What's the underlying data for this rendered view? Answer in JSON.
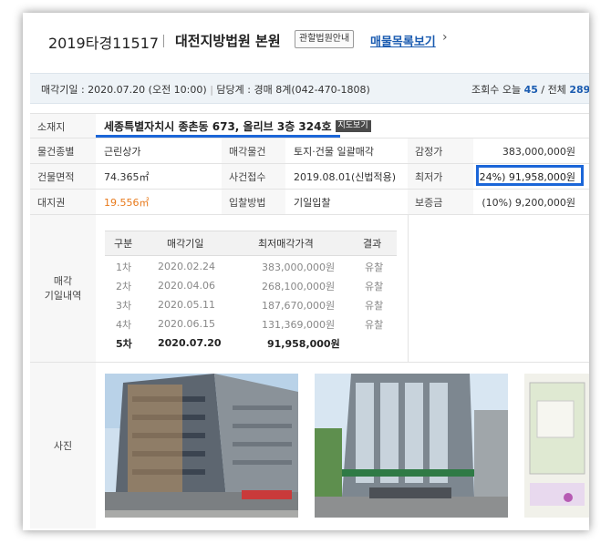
{
  "header": {
    "case_no": "2019타경11517",
    "court": "대전지방법원 본원",
    "court_info_button": "관할법원안내",
    "list_link": "매물목록보기",
    "list_chevron": "›"
  },
  "infobar": {
    "sale_date_text": "매각기일 : 2020.07.20 (오전 10:00)",
    "divider": "|",
    "department_text": "담당계 : 경매 8계(042-470-1808)",
    "views_label": "조회수 오늘",
    "views_today": "45",
    "views_sep": "/ 전체",
    "views_total": "289"
  },
  "property": {
    "location_label": "소재지",
    "address": "세종특별자치시 종촌동 673, 올리브 3층 324호",
    "map_button": "지도보기",
    "rows": [
      {
        "l1": "물건종별",
        "v1": "근린상가",
        "l2": "매각물건",
        "v2": "토지·건물 일괄매각",
        "l3": "감정가",
        "v3": "383,000,000원"
      },
      {
        "l1": "건물면적",
        "v1": "74.365㎡",
        "l2": "사건접수",
        "v2": "2019.08.01(신법적용)",
        "l3": "최저가",
        "v3": "(24%) 91,958,000원"
      },
      {
        "l1": "대지권",
        "v1": "19.556㎡",
        "l2": "입찰방법",
        "v2": "기일입찰",
        "l3": "보증금",
        "v3": "(10%) 9,200,000원"
      }
    ]
  },
  "history": {
    "section_label_1": "매각",
    "section_label_2": "기일내역",
    "headers": [
      "구분",
      "매각기일",
      "최저매각가격",
      "결과"
    ],
    "rows": [
      {
        "round": "1차",
        "date": "2020.02.24",
        "price": "383,000,000원",
        "result": "유찰"
      },
      {
        "round": "2차",
        "date": "2020.04.06",
        "price": "268,100,000원",
        "result": "유찰"
      },
      {
        "round": "3차",
        "date": "2020.05.11",
        "price": "187,670,000원",
        "result": "유찰"
      },
      {
        "round": "4차",
        "date": "2020.06.15",
        "price": "131,369,000원",
        "result": "유찰"
      },
      {
        "round": "5차",
        "date": "2020.07.20",
        "price": "91,958,000원",
        "result": ""
      }
    ]
  },
  "photos": {
    "label": "사진"
  },
  "colors": {
    "accent": "#1b66d8",
    "link": "#1a5bb0",
    "area_orange": "#e87a1c"
  }
}
